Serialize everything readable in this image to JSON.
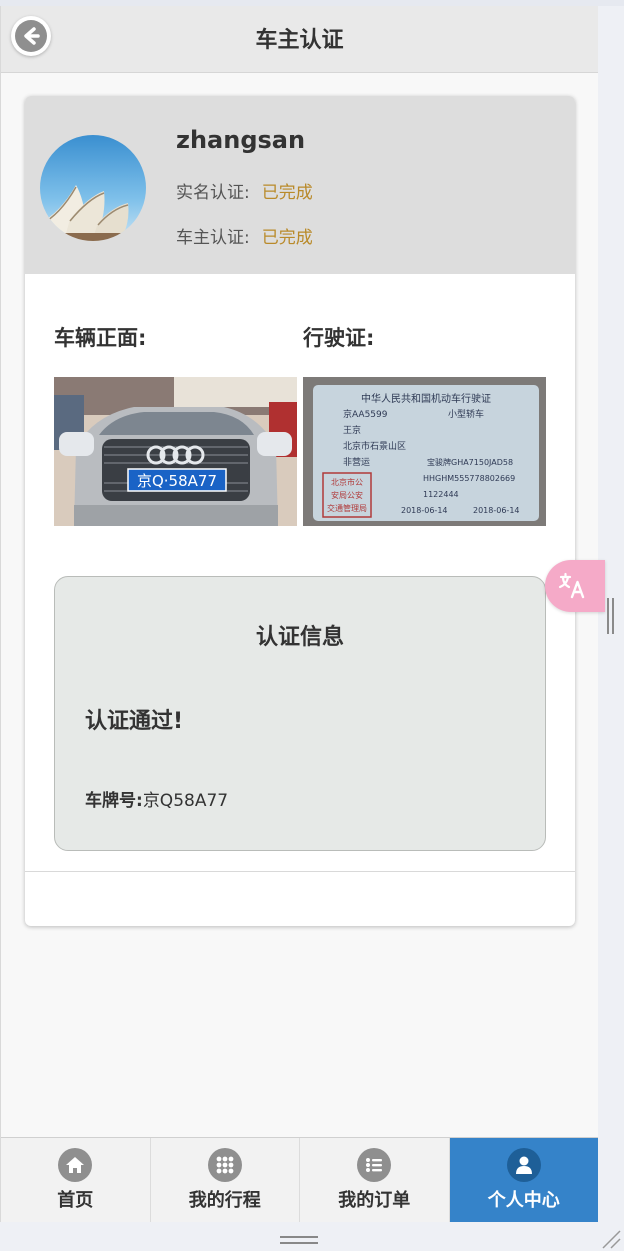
{
  "header": {
    "title": "车主认证",
    "back_icon": "back-arrow-icon"
  },
  "profile": {
    "username": "zhangsan",
    "realname_label": "实名认证:",
    "realname_value": "已完成",
    "owner_label": "车主认证:",
    "owner_value": "已完成"
  },
  "photos": {
    "front_label": "车辆正面:",
    "license_label": "行驶证:",
    "plate_text": "京Q·58A77",
    "license_doc": {
      "title": "中华人民共和国机动车行驶证",
      "plate": "京AA5599",
      "vehicle_type": "小型轿车",
      "owner": "王京",
      "address": "北京市石景山区",
      "use": "非营运",
      "model": "宝骏牌GHA7150JAD58",
      "vin": "HHGHM555778802669",
      "engine": "1122444",
      "reg_date": "2018-06-14",
      "issue_date": "2018-06-14",
      "stamp": [
        "北京市公",
        "安局公安",
        "交通管理局"
      ]
    }
  },
  "info": {
    "title": "认证信息",
    "passed": "认证通过!",
    "plate_label": "车牌号:",
    "plate_value": "京Q58A77"
  },
  "nav": [
    {
      "label": "首页",
      "icon": "home-icon",
      "active": false
    },
    {
      "label": "我的行程",
      "icon": "grid-icon",
      "active": false
    },
    {
      "label": "我的订单",
      "icon": "list-icon",
      "active": false
    },
    {
      "label": "个人中心",
      "icon": "user-icon",
      "active": true
    }
  ],
  "translate_fab": {
    "icon": "translate-icon"
  },
  "colors": {
    "accent": "#3583c9",
    "status": "#b98a2a",
    "fab": "#f5aac8"
  }
}
